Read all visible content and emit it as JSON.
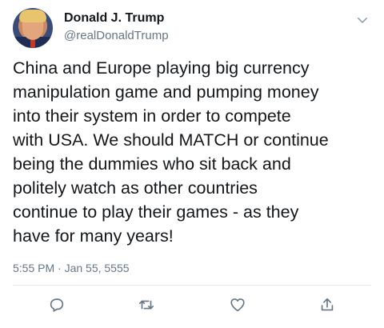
{
  "header": {
    "display_name": "Donald J. Trump",
    "handle": "@realDonaldTrump",
    "avatar_icon": "profile-photo",
    "menu_icon": "chevron-down-icon"
  },
  "tweet": {
    "text": "China and Europe playing big currency\nmanipulation game and pumping money\ninto their system in order to compete\nwith USA. We should MATCH or continue\nbeing the dummies who sit back and\npolitely watch as other countries\ncontinue to play their games - as they\nhave for many years!",
    "timestamp": "5:55 PM · Jan 55, 5555"
  },
  "actions": [
    {
      "name": "reply",
      "icon": "reply-icon"
    },
    {
      "name": "retweet",
      "icon": "retweet-icon"
    },
    {
      "name": "like",
      "icon": "heart-icon"
    },
    {
      "name": "share",
      "icon": "share-icon"
    }
  ],
  "colors": {
    "text": "#14171a",
    "secondary": "#657786",
    "divider": "#e1e8ed"
  }
}
